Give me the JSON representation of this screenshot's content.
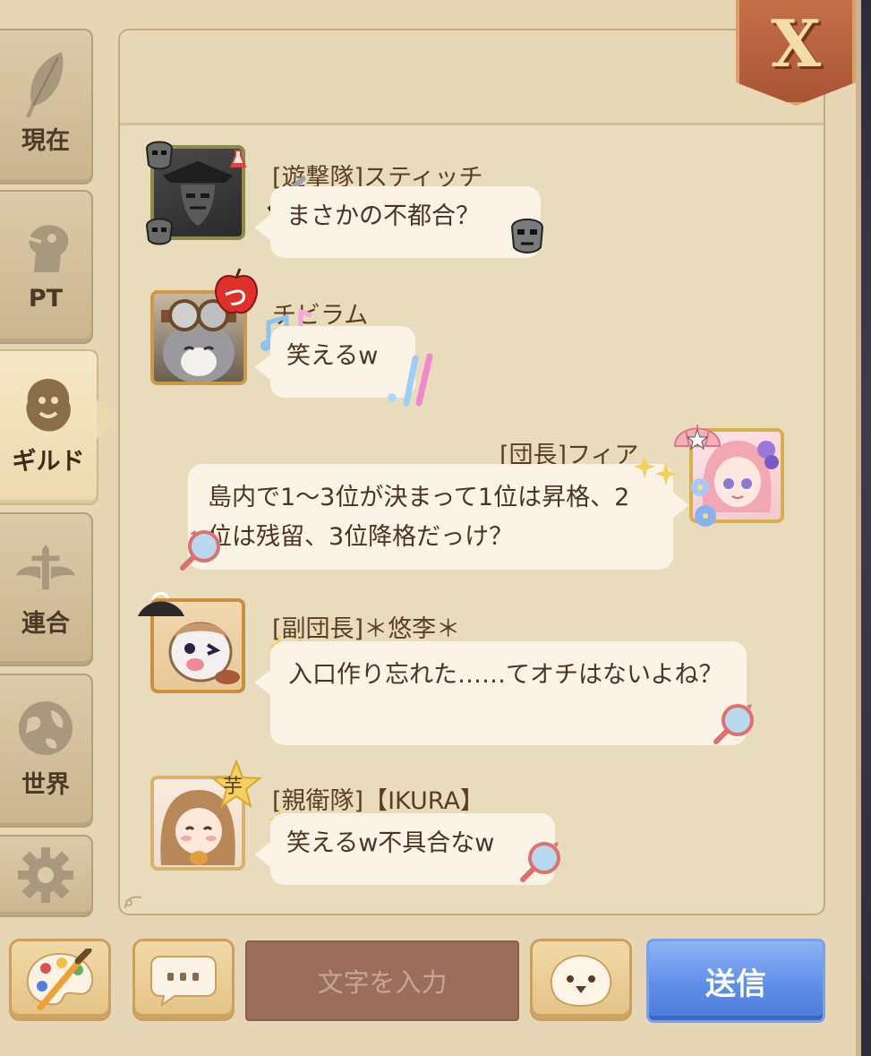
{
  "sidebar": {
    "tabs": [
      {
        "label": "現在",
        "icon": "feather-icon",
        "active": false
      },
      {
        "label": "PT",
        "icon": "horse-head-icon",
        "active": false
      },
      {
        "label": "ギルド",
        "icon": "lion-crest-icon",
        "active": true
      },
      {
        "label": "連合",
        "icon": "winged-sword-icon",
        "active": false
      },
      {
        "label": "世界",
        "icon": "globe-icon",
        "active": false
      },
      {
        "label": "",
        "icon": "gear-icon",
        "active": false
      }
    ]
  },
  "close_button": {
    "label": "X"
  },
  "messages": [
    {
      "sender": "[遊撃隊]スティッチ",
      "text": "まさかの不都合？",
      "side": "left",
      "avatar": "masked-knight-avatar"
    },
    {
      "sender": "チビラム",
      "text": "笑えるw",
      "side": "left",
      "avatar": "hamster-goggles-avatar",
      "badge": "つ"
    },
    {
      "sender": "[団長]フィア",
      "text": "島内で1～3位が決まって1位は昇格、2位は残留、3位降格だっけ？",
      "side": "right",
      "avatar": "pink-hair-girl-avatar"
    },
    {
      "sender": "[副団長]＊悠李＊",
      "text": "入口作り忘れた……てオチはないよね？",
      "side": "left",
      "avatar": "penguin-pirate-avatar"
    },
    {
      "sender": "[親衛隊]【IKURA】",
      "text": "笑えるw不具合なw",
      "side": "left",
      "avatar": "brown-hair-girl-avatar",
      "badge": "芋"
    }
  ],
  "bottom_bar": {
    "palette_icon": "palette-icon",
    "chat_channel_icon": "speech-bubble-icon",
    "input_placeholder": "文字を入力",
    "emoji_icon": "smiley-face-icon",
    "send_label": "送信"
  },
  "colors": {
    "panel_bg": "#e9dcbd",
    "bubble_bg": "#fbf3e6",
    "close_button": "#b35c3b",
    "send_button": "#5e8fe8"
  }
}
